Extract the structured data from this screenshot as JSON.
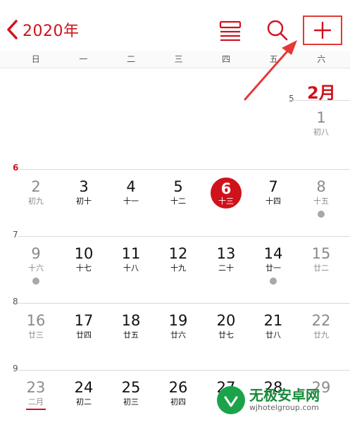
{
  "header": {
    "year_label": "2020年"
  },
  "weekdays": [
    "日",
    "一",
    "二",
    "三",
    "四",
    "五",
    "六"
  ],
  "month_label": "2月",
  "weeks": [
    {
      "number": "5",
      "highlight": false,
      "days": [
        {
          "day": "1",
          "lunar": "初八",
          "weekend": true
        }
      ]
    },
    {
      "number": "6",
      "highlight": true,
      "days": [
        {
          "day": "2",
          "lunar": "初九",
          "weekend": true
        },
        {
          "day": "3",
          "lunar": "初十"
        },
        {
          "day": "4",
          "lunar": "十一"
        },
        {
          "day": "5",
          "lunar": "十二"
        },
        {
          "day": "6",
          "lunar": "十三",
          "today": true
        },
        {
          "day": "7",
          "lunar": "十四"
        },
        {
          "day": "8",
          "lunar": "十五",
          "weekend": true,
          "event": true
        }
      ]
    },
    {
      "number": "7",
      "highlight": false,
      "days": [
        {
          "day": "9",
          "lunar": "十六",
          "weekend": true,
          "event": true
        },
        {
          "day": "10",
          "lunar": "十七"
        },
        {
          "day": "11",
          "lunar": "十八"
        },
        {
          "day": "12",
          "lunar": "十九"
        },
        {
          "day": "13",
          "lunar": "二十"
        },
        {
          "day": "14",
          "lunar": "廿一",
          "event": true
        },
        {
          "day": "15",
          "lunar": "廿二",
          "weekend": true
        }
      ]
    },
    {
      "number": "8",
      "highlight": false,
      "days": [
        {
          "day": "16",
          "lunar": "廿三",
          "weekend": true
        },
        {
          "day": "17",
          "lunar": "廿四"
        },
        {
          "day": "18",
          "lunar": "廿五"
        },
        {
          "day": "19",
          "lunar": "廿六"
        },
        {
          "day": "20",
          "lunar": "廿七"
        },
        {
          "day": "21",
          "lunar": "廿八"
        },
        {
          "day": "22",
          "lunar": "廿九",
          "weekend": true
        }
      ]
    },
    {
      "number": "9",
      "highlight": false,
      "days": [
        {
          "day": "23",
          "lunar": "二月",
          "weekend": true,
          "underline": true
        },
        {
          "day": "24",
          "lunar": "初二"
        },
        {
          "day": "25",
          "lunar": "初三"
        },
        {
          "day": "26",
          "lunar": "初四"
        },
        {
          "day": "27",
          "lunar": ""
        },
        {
          "day": "28",
          "lunar": ""
        },
        {
          "day": "29",
          "lunar": "",
          "weekend": true
        }
      ]
    }
  ],
  "watermark": {
    "title": "无极安卓网",
    "url": "wjhotelgroup.com"
  },
  "colors": {
    "accent": "#d0121b",
    "annotation": "#e53935",
    "event_dot": "#a8a8a8"
  },
  "icons": {
    "back": "chevron-left-icon",
    "list": "list-view-icon",
    "search": "search-icon",
    "add": "plus-icon"
  }
}
